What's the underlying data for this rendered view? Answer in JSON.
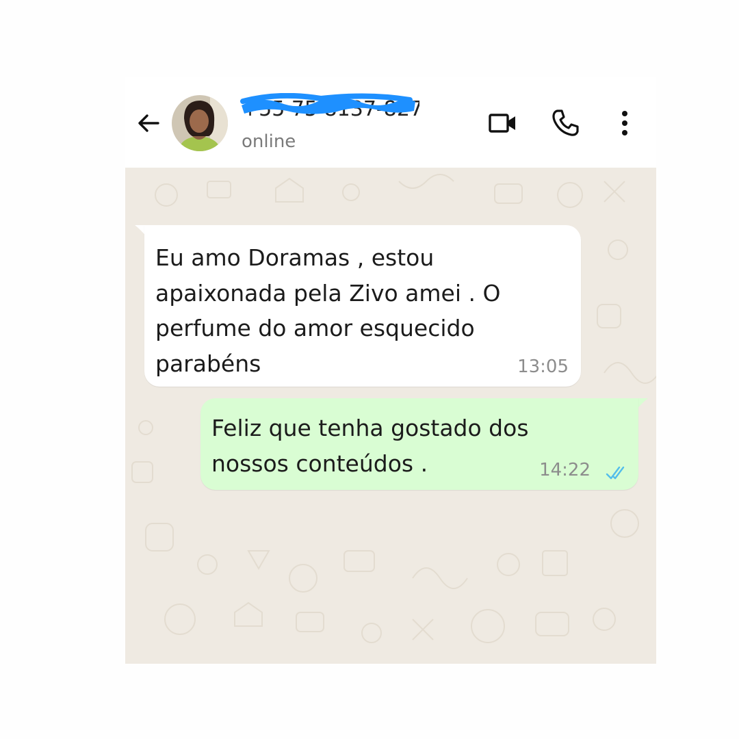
{
  "header": {
    "back_icon": "arrow-left-icon",
    "contact_name": "+55 75 8137-8273",
    "status": "online",
    "actions": [
      "video-camera-icon",
      "phone-icon",
      "more-vertical-icon"
    ]
  },
  "messages": [
    {
      "direction": "incoming",
      "text": "Eu amo Doramas , estou\napaixonada pela Zivo amei . O\nperfume do amor esquecido\nparabéns",
      "time": "13:05"
    },
    {
      "direction": "outgoing",
      "text": "Feliz que tenha gostado dos\nnossos conteúdos .",
      "time": "14:22",
      "status_icon": "double-check-read-icon"
    }
  ],
  "colors": {
    "header_bg": "#ffffff",
    "chat_bg": "#efeae2",
    "incoming_bubble": "#ffffff",
    "outgoing_bubble": "#d9fdd3",
    "read_tick": "#53bdeb",
    "redaction": "#1e90ff"
  }
}
